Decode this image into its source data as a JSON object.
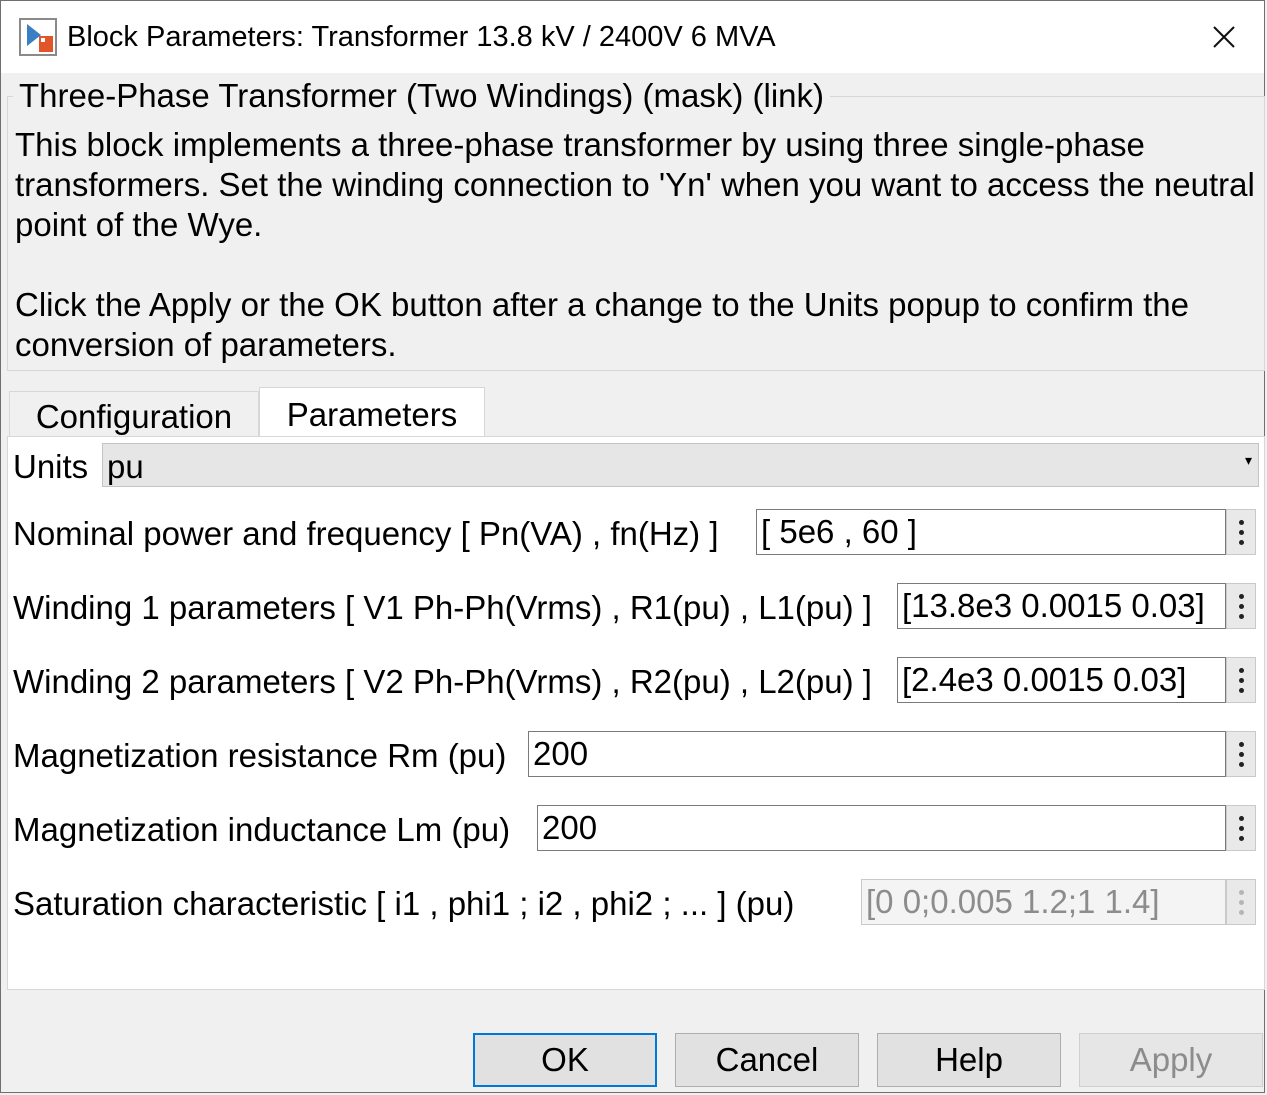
{
  "window": {
    "title": "Block Parameters: Transformer 13.8 kV / 2400V 6 MVA"
  },
  "mask": {
    "group_title": "Three-Phase Transformer (Two Windings) (mask) (link)",
    "description_1": "This block implements a three-phase transformer by using three single-phase transformers. Set the winding connection to 'Yn'  when you want to access the neutral point of the Wye.",
    "description_2": "Click the Apply or the OK button after a change to the Units popup to confirm the conversion of parameters."
  },
  "tabs": [
    {
      "label": "Configuration",
      "active": false
    },
    {
      "label": "Parameters",
      "active": true
    }
  ],
  "units": {
    "label": "Units",
    "selected": "pu"
  },
  "params": [
    {
      "label": "Nominal power and frequency  [ Pn(VA) , fn(Hz) ]",
      "value": "[ 5e6 , 60 ]",
      "enabled": true
    },
    {
      "label": "Winding 1 parameters [ V1 Ph-Ph(Vrms) , R1(pu) , L1(pu) ]",
      "value": "[13.8e3 0.0015 0.03]",
      "enabled": true
    },
    {
      "label": "Winding 2 parameters [ V2 Ph-Ph(Vrms) , R2(pu) , L2(pu) ]",
      "value": "[2.4e3 0.0015 0.03]",
      "enabled": true
    },
    {
      "label": "Magnetization resistance  Rm (pu)",
      "value": "200",
      "enabled": true
    },
    {
      "label": "Magnetization inductance  Lm (pu)",
      "value": "200",
      "enabled": true
    },
    {
      "label": "Saturation characteristic [ i1 ,  phi1 ;  i2 , phi2 ; ... ] (pu)",
      "value": "[0 0;0.005 1.2;1 1.4]",
      "enabled": false
    }
  ],
  "buttons": {
    "ok": "OK",
    "cancel": "Cancel",
    "help": "Help",
    "apply": "Apply"
  },
  "colors": {
    "default_button_border": "#0078d7",
    "disabled_text": "#8c8c8c"
  }
}
